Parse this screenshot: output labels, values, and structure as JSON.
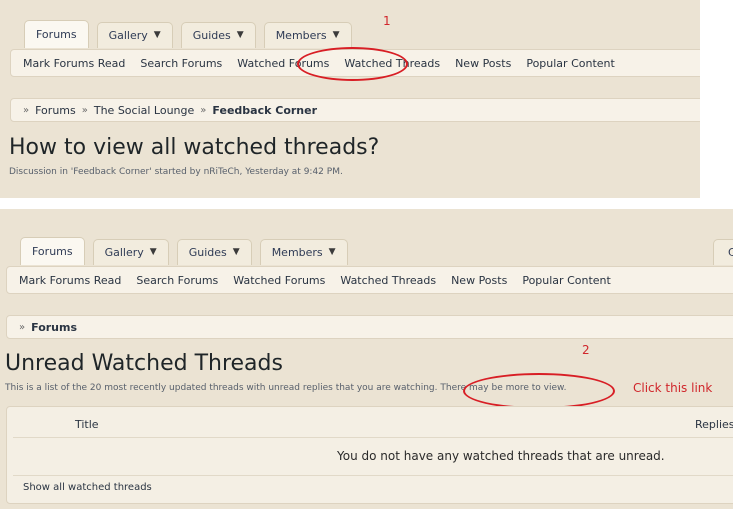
{
  "top": {
    "annotation_number": "1",
    "tabs": [
      {
        "label": "Forums"
      },
      {
        "label": "Gallery"
      },
      {
        "label": "Guides"
      },
      {
        "label": "Members"
      }
    ],
    "subnav": [
      "Mark Forums Read",
      "Search Forums",
      "Watched Forums",
      "Watched Threads",
      "New Posts",
      "Popular Content"
    ],
    "breadcrumb": [
      "Forums",
      "The Social Lounge",
      "Feedback Corner"
    ],
    "title": "How to view all watched threads?",
    "meta": "Discussion in 'Feedback Corner' started by nRiTeCh, Yesterday at 9:42 PM."
  },
  "bottom": {
    "annotation_number": "2",
    "annotation_text": "Click this link",
    "edge_tab": "C",
    "tabs": [
      {
        "label": "Forums"
      },
      {
        "label": "Gallery"
      },
      {
        "label": "Guides"
      },
      {
        "label": "Members"
      }
    ],
    "subnav": [
      "Mark Forums Read",
      "Search Forums",
      "Watched Forums",
      "Watched Threads",
      "New Posts",
      "Popular Content"
    ],
    "breadcrumb": [
      "Forums"
    ],
    "title": "Unread Watched Threads",
    "description": "This is a list of the 20 most recently updated threads with unread replies that you are watching.",
    "more_link": "There may be more to view.",
    "table": {
      "col_title": "Title",
      "col_replies": "Replies",
      "empty_message": "You do not have any watched threads that are unread.",
      "footer_link": "Show all watched threads"
    }
  },
  "colors": {
    "background": "#ebe3d3",
    "annotation": "#d0262b",
    "link": "#2a3442"
  },
  "icons": {
    "dropdown": "chevron-down-icon",
    "breadcrumb_separator": "double-chevron-right-icon"
  }
}
